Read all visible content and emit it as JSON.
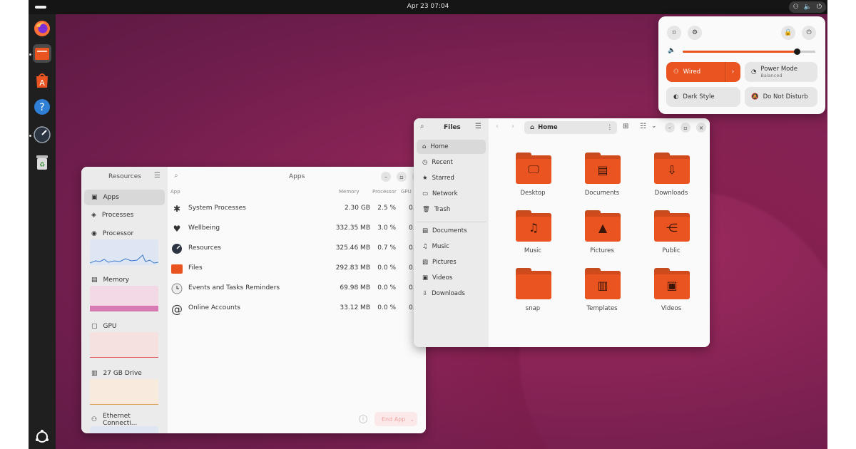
{
  "topbar": {
    "clock": "Apr 23  07:04",
    "tray_icons": [
      "network-icon",
      "volume-icon",
      "power-icon"
    ]
  },
  "dock": {
    "apps": [
      "Firefox",
      "Files",
      "App Center",
      "Help",
      "Resources",
      "Trash",
      "Show Apps"
    ]
  },
  "resources": {
    "sidebar_title": "Resources",
    "main_title": "Apps",
    "sidebar": [
      {
        "label": "Apps",
        "selected": true
      },
      {
        "label": "Processes"
      },
      {
        "label": "Processor"
      },
      {
        "label": "Memory"
      },
      {
        "label": "GPU"
      },
      {
        "label": "27 GB Drive"
      },
      {
        "label": "Ethernet Connecti..."
      }
    ],
    "columns": {
      "app": "App",
      "memory": "Memory",
      "processor": "Processor",
      "gpu": "GPU"
    },
    "rows": [
      {
        "name": "System Processes",
        "memory": "2.30 GB",
        "processor": "2.5 %",
        "gpu": "0."
      },
      {
        "name": "Wellbeing",
        "memory": "332.35 MB",
        "processor": "3.0 %",
        "gpu": "0."
      },
      {
        "name": "Resources",
        "memory": "325.46 MB",
        "processor": "0.7 %",
        "gpu": "0."
      },
      {
        "name": "Files",
        "memory": "292.83 MB",
        "processor": "0.0 %",
        "gpu": "0."
      },
      {
        "name": "Events and Tasks Reminders",
        "memory": "69.98 MB",
        "processor": "0.0 %",
        "gpu": "0."
      },
      {
        "name": "Online Accounts",
        "memory": "33.12 MB",
        "processor": "0.0 %",
        "gpu": "0."
      }
    ],
    "end_app": "End App"
  },
  "files": {
    "sidebar_title": "Files",
    "path": "Home",
    "places": [
      {
        "label": "Home",
        "selected": true
      },
      {
        "label": "Recent"
      },
      {
        "label": "Starred"
      },
      {
        "label": "Network"
      },
      {
        "label": "Trash"
      }
    ],
    "bookmarks": [
      {
        "label": "Documents"
      },
      {
        "label": "Music"
      },
      {
        "label": "Pictures"
      },
      {
        "label": "Videos"
      },
      {
        "label": "Downloads"
      }
    ],
    "folders": [
      {
        "label": "Desktop",
        "icon": "monitor-icon"
      },
      {
        "label": "Documents",
        "icon": "document-icon"
      },
      {
        "label": "Downloads",
        "icon": "download-icon"
      },
      {
        "label": "Music",
        "icon": "music-icon"
      },
      {
        "label": "Pictures",
        "icon": "picture-icon"
      },
      {
        "label": "Public",
        "icon": "share-icon"
      },
      {
        "label": "snap",
        "icon": "folder-icon"
      },
      {
        "label": "Templates",
        "icon": "template-icon"
      },
      {
        "label": "Videos",
        "icon": "film-icon"
      }
    ]
  },
  "quick_settings": {
    "volume_level": 0.86,
    "wired_label": "Wired",
    "power_mode_label": "Power Mode",
    "power_mode_value": "Balanced",
    "dark_style_label": "Dark Style",
    "dnd_label": "Do Not Disturb",
    "accent": "#e95420"
  }
}
